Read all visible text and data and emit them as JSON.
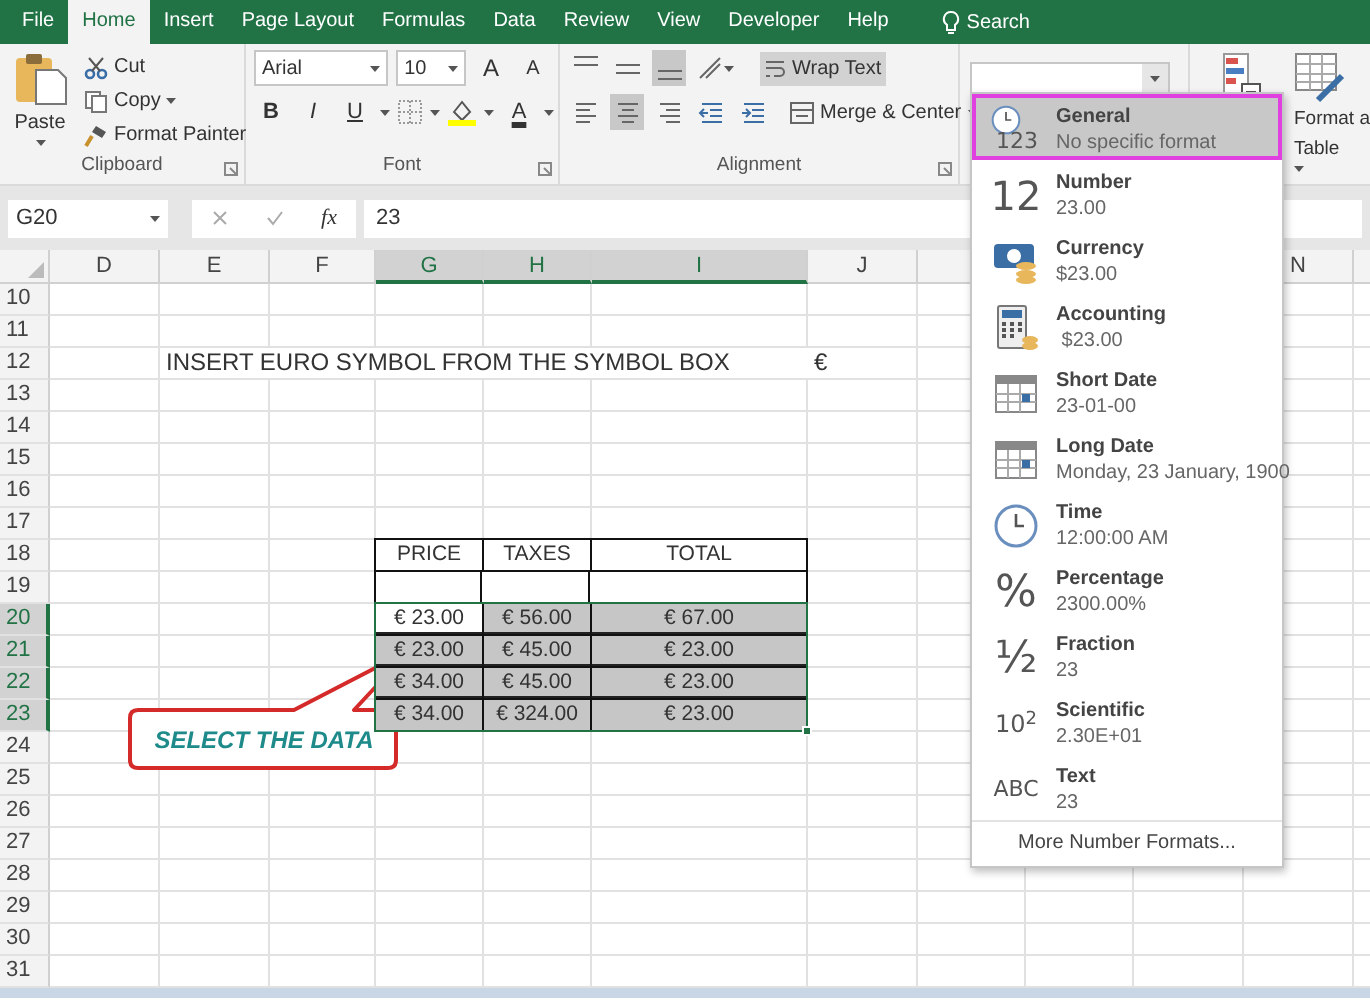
{
  "menu_tabs": [
    {
      "label": "File",
      "selected": false
    },
    {
      "label": "Home",
      "selected": true
    },
    {
      "label": "Insert",
      "selected": false
    },
    {
      "label": "Page Layout",
      "selected": false
    },
    {
      "label": "Formulas",
      "selected": false
    },
    {
      "label": "Data",
      "selected": false
    },
    {
      "label": "Review",
      "selected": false
    },
    {
      "label": "View",
      "selected": false
    },
    {
      "label": "Developer",
      "selected": false
    },
    {
      "label": "Help",
      "selected": false
    }
  ],
  "search": {
    "label": "Search"
  },
  "ribbon": {
    "clipboard": {
      "paste": "Paste",
      "cut": "Cut",
      "copy": "Copy",
      "format_painter": "Format Painter",
      "label": "Clipboard"
    },
    "font": {
      "font_name": "Arial",
      "font_size": "10",
      "grow": "A",
      "shrink": "A",
      "style_buttons": [
        "B",
        "I",
        "U"
      ],
      "font_color": "A",
      "label": "Font"
    },
    "alignment": {
      "top_row": [
        {
          "kind": "top",
          "on": false
        },
        {
          "kind": "middle",
          "on": false
        },
        {
          "kind": "bottom",
          "on": true
        },
        {
          "kind": "orientation",
          "on": false
        }
      ],
      "bottom_row": [
        {
          "kind": "left",
          "on": false
        },
        {
          "kind": "center",
          "on": true
        },
        {
          "kind": "right",
          "on": false
        },
        {
          "kind": "outdent",
          "on": false
        },
        {
          "kind": "indent",
          "on": false
        }
      ],
      "wrap_text": {
        "label": "Wrap Text",
        "on": true
      },
      "merge": "Merge & Center",
      "label": "Alignment"
    },
    "styles": {
      "format_as_table": [
        "Format a",
        "Table"
      ]
    }
  },
  "formula_bar": {
    "name_box": "G20",
    "fx": "fx",
    "value": "23"
  },
  "sheet": {
    "columns": [
      {
        "label": "D",
        "selected": false
      },
      {
        "label": "E",
        "selected": false
      },
      {
        "label": "F",
        "selected": false
      },
      {
        "label": "G",
        "selected": true
      },
      {
        "label": "H",
        "selected": true
      },
      {
        "label": "I",
        "selected": true
      },
      {
        "label": "J",
        "selected": false
      },
      {
        "label": "N",
        "selected": false
      }
    ],
    "rows": [
      {
        "number": "10",
        "selected": false
      },
      {
        "number": "11",
        "selected": false
      },
      {
        "number": "12",
        "selected": false
      },
      {
        "number": "13",
        "selected": false
      },
      {
        "number": "14",
        "selected": false
      },
      {
        "number": "15",
        "selected": false
      },
      {
        "number": "16",
        "selected": false
      },
      {
        "number": "17",
        "selected": false
      },
      {
        "number": "18",
        "selected": false
      },
      {
        "number": "19",
        "selected": false
      },
      {
        "number": "20",
        "selected": true
      },
      {
        "number": "21",
        "selected": true
      },
      {
        "number": "22",
        "selected": true
      },
      {
        "number": "23",
        "selected": true
      },
      {
        "number": "24",
        "selected": false
      },
      {
        "number": "25",
        "selected": false
      },
      {
        "number": "26",
        "selected": false
      },
      {
        "number": "27",
        "selected": false
      },
      {
        "number": "28",
        "selected": false
      },
      {
        "number": "29",
        "selected": false
      },
      {
        "number": "30",
        "selected": false
      },
      {
        "number": "31",
        "selected": false
      }
    ],
    "note": {
      "text": "INSERT EURO SYMBOL FROM THE SYMBOL BOX",
      "symbol": "€"
    },
    "table": {
      "headers": [
        "PRICE",
        "TAXES",
        "TOTAL"
      ],
      "rows": [
        [
          {
            "text": "€ 23.00",
            "highlighted": false
          },
          {
            "text": "€ 56.00",
            "highlighted": true
          },
          {
            "text": "€ 67.00",
            "highlighted": true
          }
        ],
        [
          {
            "text": "€ 23.00",
            "highlighted": true
          },
          {
            "text": "€ 45.00",
            "highlighted": true
          },
          {
            "text": "€ 23.00",
            "highlighted": true
          }
        ],
        [
          {
            "text": "€ 34.00",
            "highlighted": true
          },
          {
            "text": "€ 45.00",
            "highlighted": true
          },
          {
            "text": "€ 23.00",
            "highlighted": true
          }
        ],
        [
          {
            "text": "€ 34.00",
            "highlighted": true
          },
          {
            "text": "€ 324.00",
            "highlighted": true
          },
          {
            "text": "€ 23.00",
            "highlighted": true
          }
        ]
      ]
    }
  },
  "callout": {
    "text": "SELECT THE DATA"
  },
  "format_menu": {
    "items": [
      {
        "kind": "general",
        "icon_text": "123",
        "name": "General",
        "example": "No specific format",
        "selected": true
      },
      {
        "kind": "number",
        "icon_text": "12",
        "name": "Number",
        "example": "23.00",
        "selected": false
      },
      {
        "kind": "currency",
        "name": "Currency",
        "example": "$23.00",
        "selected": false
      },
      {
        "kind": "accounting",
        "name": "Accounting",
        "example": " $23.00",
        "selected": false
      },
      {
        "kind": "short-date",
        "name": "Short Date",
        "example": "23-01-00",
        "selected": false
      },
      {
        "kind": "long-date",
        "name": "Long Date",
        "example": "Monday, 23 January, 1900",
        "selected": false
      },
      {
        "kind": "time",
        "name": "Time",
        "example": "12:00:00 AM",
        "selected": false
      },
      {
        "kind": "percentage",
        "icon_text": "%",
        "name": "Percentage",
        "example": "2300.00%",
        "selected": false
      },
      {
        "kind": "fraction",
        "icon_text": "½",
        "name": "Fraction",
        "example": "23",
        "selected": false
      },
      {
        "kind": "scientific",
        "icon_text": "10$^{2}$",
        "name": "Scientific",
        "example": "2.30E+01",
        "selected": false
      },
      {
        "kind": "text",
        "icon_text": "ABC",
        "name": "Text",
        "example": "23",
        "selected": false
      }
    ],
    "footer": "More Number Formats..."
  }
}
